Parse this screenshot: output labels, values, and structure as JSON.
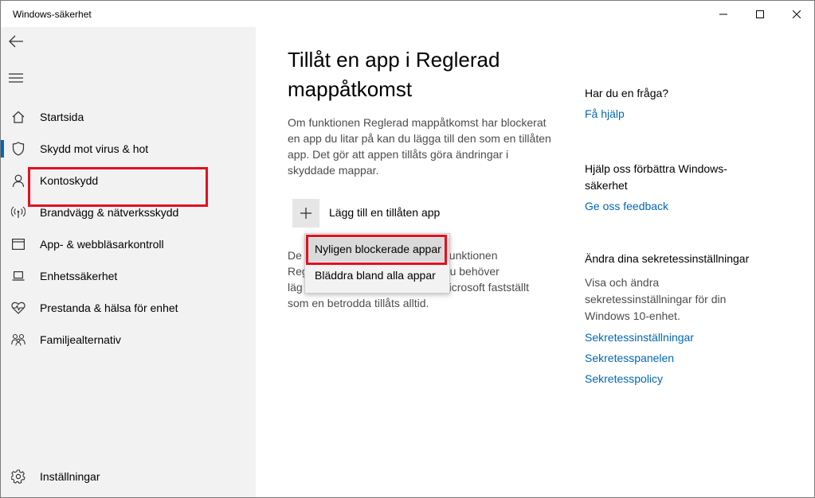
{
  "window": {
    "title": "Windows-säkerhet"
  },
  "sidebar": {
    "items": [
      {
        "label": "Startsida",
        "icon": "home-icon"
      },
      {
        "label": "Skydd mot virus & hot",
        "icon": "shield-icon",
        "active": true
      },
      {
        "label": "Kontoskydd",
        "icon": "person-icon"
      },
      {
        "label": "Brandvägg & nätverksskydd",
        "icon": "antenna-icon"
      },
      {
        "label": "App- & webbläsarkontroll",
        "icon": "app-window-icon"
      },
      {
        "label": "Enhetssäkerhet",
        "icon": "laptop-icon"
      },
      {
        "label": "Prestanda & hälsa för enhet",
        "icon": "heart-pulse-icon"
      },
      {
        "label": "Familjealternativ",
        "icon": "family-icon"
      }
    ],
    "settings_label": "Inställningar"
  },
  "main": {
    "title": "Tillåt en app i Reglerad mappåtkomst",
    "description": "Om funktionen Reglerad mappåtkomst har blockerat en app du litar på kan du lägga till den som en tillåten app. Det gör att appen tillåts göra ändringar i skyddade mappar.",
    "add_button_label": "Lägg till en tillåten app",
    "description2_lines": [
      "De",
      "Reg",
      "läg",
      "som en betrodda tillåts alltid."
    ],
    "description2_right_lines": [
      "v funktionen",
      "t du behöver",
      "Microsoft fastställt"
    ],
    "dropdown": {
      "items": [
        "Nyligen blockerade appar",
        "Bläddra bland alla appar"
      ]
    }
  },
  "right_panel": {
    "question_heading": "Har du en fråga?",
    "help_link": "Få hjälp",
    "improve_heading": "Hjälp oss förbättra Windows-säkerhet",
    "feedback_link": "Ge oss feedback",
    "privacy_heading": "Ändra dina sekretessinställningar",
    "privacy_text": "Visa och ändra sekretessinställningar för din Windows 10-enhet.",
    "privacy_links": [
      "Sekretessinställningar",
      "Sekretesspanelen",
      "Sekretesspolicy"
    ]
  },
  "colors": {
    "accent": "#0067b8",
    "highlight": "#e3101f",
    "sidebar_bg": "#f2f2f2"
  }
}
